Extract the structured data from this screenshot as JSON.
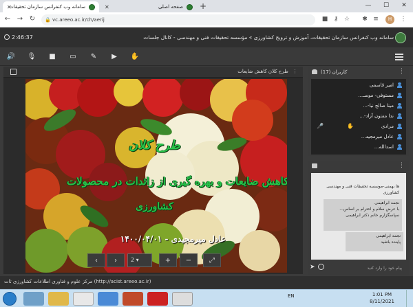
{
  "browser": {
    "tabs": [
      {
        "title": "سامانه وب کنفرانس سازمان تحقیقات..."
      },
      {
        "title": "صفحه اصلی"
      }
    ],
    "new_tab": "+",
    "url": "vc.areeo.ac.ir/ch/aerij",
    "profile_initial": "H",
    "window_controls": {
      "min": "—",
      "max": "☐",
      "close": "✕"
    }
  },
  "app": {
    "title": "سامانه وب کنفرانس سازمان تحقیقات، آموزش و ترویج کشاورزی » مؤسسه تحقیقات فنی و مهندسی - کانال جلسات",
    "timer": "2:46:37"
  },
  "presentation": {
    "title": "طرح کلان کاهش ضایعات",
    "slide_lines": [
      "طرح کلان",
      "کاهش ضایعات و بهره گیری از زائدات در محصولات",
      "کشاورزی",
      "عادل میرمجیدی - ۱۴۰۰/۰۴/۰۱"
    ],
    "page_value": "2",
    "controls": {
      "prev": "‹",
      "next": "›",
      "zoom_in": "+",
      "zoom_out": "−",
      "fit": "⤢"
    }
  },
  "users": {
    "title": "کاربران (17)",
    "list": [
      {
        "name": "امیر قاسمی"
      },
      {
        "name": "مستوفی- موسـ..."
      },
      {
        "name": "مینا صالح نیا-..."
      },
      {
        "name": "ندا مفتون آزاد-..."
      },
      {
        "name": "مرادی"
      },
      {
        "name": "عادل میرمجید..."
      },
      {
        "name": "اسدالله..."
      }
    ]
  },
  "chat": {
    "messages": [
      "ها بهمنی-موسسه تحقیقات فنی و مهندسی کشاورزی",
      "نجمه ابراهیمی\nبا عرض سلام و احترام بر اساس... سپاسگزارم خانم دکتر ابراهیمی",
      "نجمه ابراهیمی\nپاینده باشید"
    ],
    "placeholder": "پیام خود را وارد کنید"
  },
  "status": {
    "text": "مرکز علوم و فناوری اطلاعات کشاورزی ثات (http://acist.areeo.ac.ir)"
  },
  "taskbar": {
    "lang": "EN",
    "time": "1:01 PM",
    "date": "8/11/2021"
  }
}
